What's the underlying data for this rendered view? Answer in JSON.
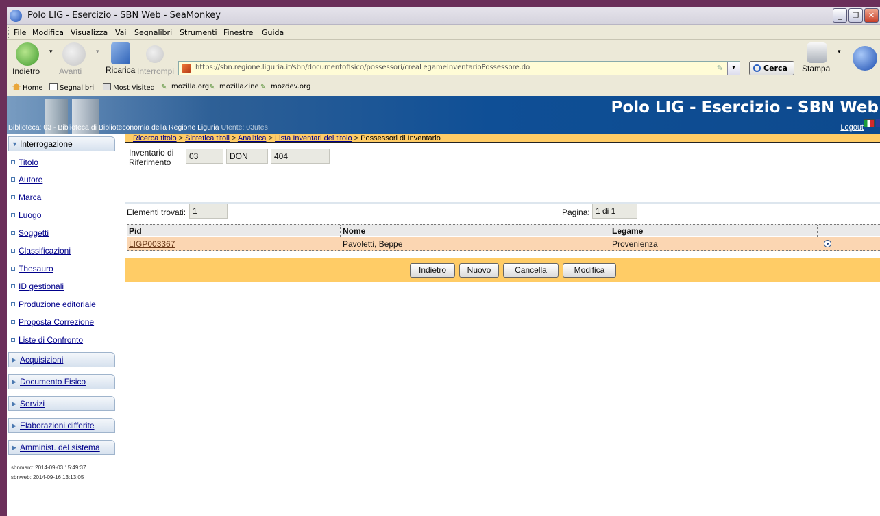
{
  "window": {
    "title": "Polo LIG - Esercizio - SBN Web - SeaMonkey",
    "buttons": [
      "minimize",
      "restore",
      "close"
    ]
  },
  "menubar": {
    "items": [
      "File",
      "Modifica",
      "Visualizza",
      "Vai",
      "Segnalibri",
      "Strumenti",
      "Finestre",
      "Guida"
    ]
  },
  "navbar": {
    "back_label": "Indietro",
    "forward_label": "Avanti",
    "reload_label": "Ricarica",
    "stop_label": "Interrompi",
    "print_label": "Stampa",
    "url_host": "https://sbn.regione.liguria.it/sbn/documentofisico/possessori/creaLegameInventarioPossessore.do",
    "search_label": "Cerca"
  },
  "bookmarks": {
    "items": [
      "Home",
      "Segnalibri",
      "Most Visited",
      "mozilla.org",
      "mozillaZine",
      "mozdev.org"
    ]
  },
  "banner": {
    "title": "Polo LIG - Esercizio - SBN Web",
    "library_info": "Biblioteca: 03 - Biblioteca di Biblioteconomia della Regione Liguria",
    "user_info": "Utente: 03utes",
    "logout": "Logout"
  },
  "sidebar": {
    "interrogazione": "Interrogazione",
    "items": [
      "Titolo",
      "Autore",
      "Marca",
      "Luogo",
      "Soggetti",
      "Classificazioni",
      "Thesauro",
      "ID gestionali",
      "Produzione editoriale",
      "Proposta Correzione",
      "Liste di Confronto"
    ],
    "sections": [
      "Acquisizioni",
      "Documento Fisico",
      "Servizi",
      "Elaborazioni differite",
      "Amminist. del sistema"
    ],
    "timestamps": [
      "sbnmarc: 2014-09-03 15:49:37",
      "sbnweb: 2014-09-16 13:13:05"
    ]
  },
  "breadcrumb": {
    "links": [
      "Ricerca titolo",
      "Sintetica titoli",
      "Analitica",
      "Lista Inventari del titolo"
    ],
    "current": "Possessori di Inventario",
    "separator": ">"
  },
  "inventario": {
    "label_line1": "Inventario di",
    "label_line2": "Riferimento",
    "biblioteca": "03",
    "serie": "DON",
    "numero": "404"
  },
  "results": {
    "found_label": "Elementi trovati:",
    "found_value": "1",
    "page_label": "Pagina:",
    "page_value": "1 di 1"
  },
  "table": {
    "headers": [
      "Pid",
      "Nome",
      "Legame"
    ],
    "rows": [
      {
        "pid": "LIGP003367",
        "nome": "Pavoletti, Beppe",
        "legame": "Provenienza",
        "selected": true
      }
    ]
  },
  "actions": {
    "indietro": "Indietro",
    "nuovo": "Nuovo",
    "cancella": "Cancella",
    "modifica": "Modifica"
  }
}
